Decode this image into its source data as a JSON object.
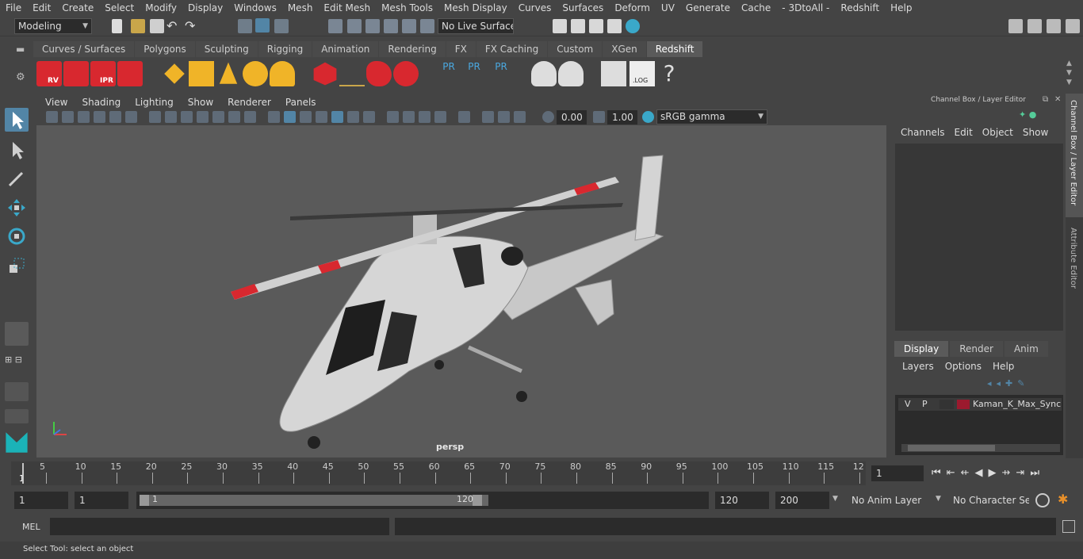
{
  "menubar": {
    "items": [
      "File",
      "Edit",
      "Create",
      "Select",
      "Modify",
      "Display",
      "Windows",
      "Mesh",
      "Edit Mesh",
      "Mesh Tools",
      "Mesh Display",
      "Curves",
      "Surfaces",
      "Deform",
      "UV",
      "Generate",
      "Cache",
      "- 3DtoAll -",
      "Redshift",
      "Help"
    ]
  },
  "statusline": {
    "workspace": "Modeling",
    "live_surface": "No Live Surface"
  },
  "shelf": {
    "tabs": [
      "Curves / Surfaces",
      "Polygons",
      "Sculpting",
      "Rigging",
      "Animation",
      "Rendering",
      "FX",
      "FX Caching",
      "Custom",
      "XGen",
      "Redshift"
    ],
    "active_tab": "Redshift",
    "button_labels": {
      "rv": "RV",
      "ipr": "IPR",
      "pr1": "PR",
      "pr2": "PR",
      "pr3": "PR",
      "log": ".LOG",
      "help": "?"
    }
  },
  "viewport": {
    "menus": [
      "View",
      "Shading",
      "Lighting",
      "Show",
      "Renderer",
      "Panels"
    ],
    "exposure": "0.00",
    "gamma": "1.00",
    "color_space": "sRGB gamma",
    "camera_label": "persp",
    "axis_labels": {
      "x": "x",
      "y": "y",
      "z": "z"
    }
  },
  "channel_box": {
    "title": "Channel Box / Layer Editor",
    "menus": [
      "Channels",
      "Edit",
      "Object",
      "Show"
    ]
  },
  "layer_editor": {
    "tabs": [
      "Display",
      "Render",
      "Anim"
    ],
    "active_tab": "Display",
    "menus": [
      "Layers",
      "Options",
      "Help"
    ],
    "layer": {
      "v": "V",
      "p": "P",
      "name": "Kaman_K_Max_Synchro",
      "color": "#9b1a2e"
    }
  },
  "side_tabs": [
    "Channel Box / Layer Editor",
    "Attribute Editor"
  ],
  "timeline": {
    "ticks": [
      "5",
      "10",
      "15",
      "20",
      "25",
      "30",
      "35",
      "40",
      "45",
      "50",
      "55",
      "60",
      "65",
      "70",
      "75",
      "80",
      "85",
      "90",
      "95",
      "100",
      "105",
      "110",
      "115",
      "12"
    ],
    "start_marker": "1",
    "current_frame": "1"
  },
  "range": {
    "start": "1",
    "playback_start": "1",
    "slider_start": "1",
    "slider_end": "120",
    "playback_end": "120",
    "end": "200",
    "anim_layer": "No Anim Layer",
    "character_set": "No Character Set"
  },
  "command_line": {
    "label": "MEL"
  },
  "help_line": {
    "text": "Select Tool: select an object"
  },
  "colors": {
    "accent": "#5285a6",
    "redshift_red": "#d8282f",
    "layer_color": "#9b1a2e"
  }
}
